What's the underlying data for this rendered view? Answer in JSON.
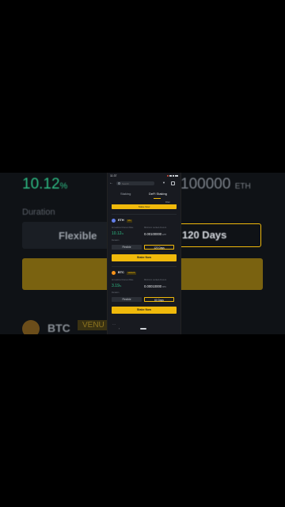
{
  "background": {
    "apy_value": "10.12",
    "apy_unit": "%",
    "min_value": "100000",
    "min_unit": "ETH",
    "duration_label": "Duration",
    "flexible_label": "Flexible",
    "days_label": "120 Days",
    "btc_label": "BTC",
    "venus_label": "VENU"
  },
  "status_bar": {
    "time": "11:37"
  },
  "search": {
    "placeholder": "Search"
  },
  "tabs": [
    {
      "label": "Staking",
      "active": false
    },
    {
      "label": "DeFi Staking",
      "active": true
    }
  ],
  "filter_chip": "Filter",
  "previous_card": {
    "stake_label": "Stake Now"
  },
  "cards": [
    {
      "coin": "ETH",
      "protocol": "lido",
      "apy_label": "Annualized Interest Rate",
      "apy_value": "10.12",
      "apy_unit": "%",
      "min_label": "Minimum Locked Amount",
      "min_value": "0.00100000",
      "min_unit": "ETH",
      "duration_label": "Duration",
      "flexible_label": "Flexible",
      "days_label": "120 Days",
      "stake_label": "Stake Now"
    },
    {
      "coin": "BTC",
      "protocol": "VENUS",
      "apy_label": "Annualized Interest Rate",
      "apy_value": "3.19",
      "apy_unit": "%",
      "min_label": "Minimum Locked Amount",
      "min_value": "0.00010000",
      "min_unit": "BTC",
      "duration_label": "Duration",
      "flexible_label": "Flexible",
      "days_label": "60 Days",
      "stake_label": "Stake Now"
    }
  ],
  "colors": {
    "accent": "#f0b90b",
    "positive": "#2ebd85",
    "panel": "#181a20",
    "eth_icon": "#627eea",
    "btc_icon": "#f7931a"
  },
  "icons": {
    "back": "arrow-left-icon",
    "search": "search-icon",
    "filter": "filter-icon",
    "history": "history-icon"
  }
}
